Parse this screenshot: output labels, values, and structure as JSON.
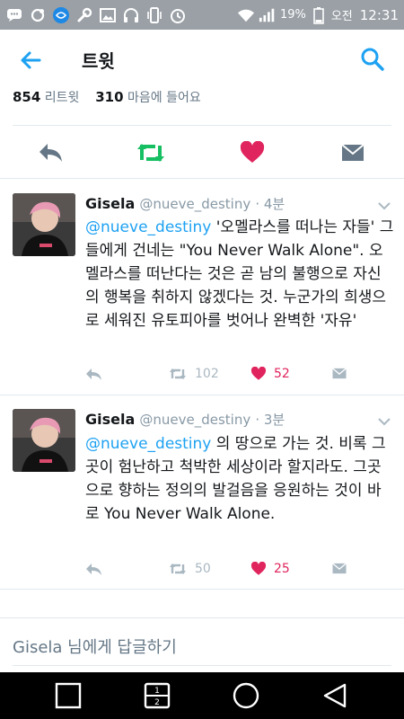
{
  "status_bar": {
    "battery": "19%",
    "period": "오전",
    "time": "12:31"
  },
  "header": {
    "title": "트윗"
  },
  "stats": {
    "retweets_count": "854",
    "retweets_label": "리트윗",
    "likes_count": "310",
    "likes_label": "마음에 들어요"
  },
  "tweets": [
    {
      "name": "Gisela",
      "handle": "@nueve_destiny",
      "time": "· 4분",
      "mention": "@nueve_destiny",
      "text": " '오멜라스를 떠나는 자들' 그들에게 건네는 \"You Never Walk Alone\".  오멜라스를 떠난다는 것은 곧 남의 불행으로 자신의 행복을 취하지 않겠다는 것. 누군가의 희생으로 세워진 유토피아를 벗어나 완벽한 '자유'",
      "retweets": "102",
      "likes": "52"
    },
    {
      "name": "Gisela",
      "handle": "@nueve_destiny",
      "time": "· 3분",
      "mention": "@nueve_destiny",
      "text": " 의 땅으로 가는 것. 비록 그곳이 험난하고 척박한 세상이라 할지라도. 그곳으로 향하는 정의의 발걸음을 응원하는 것이 바로 You Never Walk Alone.",
      "retweets": "50",
      "likes": "25"
    }
  ],
  "reply_box": {
    "name": "Gisela",
    "suffix": " 님에게 답글하기"
  },
  "colors": {
    "accent": "#1da1f2",
    "like": "#e0245e",
    "retweet": "#17bf63",
    "muted": "#aab8c2",
    "status_bar": "#9aa0a6"
  }
}
